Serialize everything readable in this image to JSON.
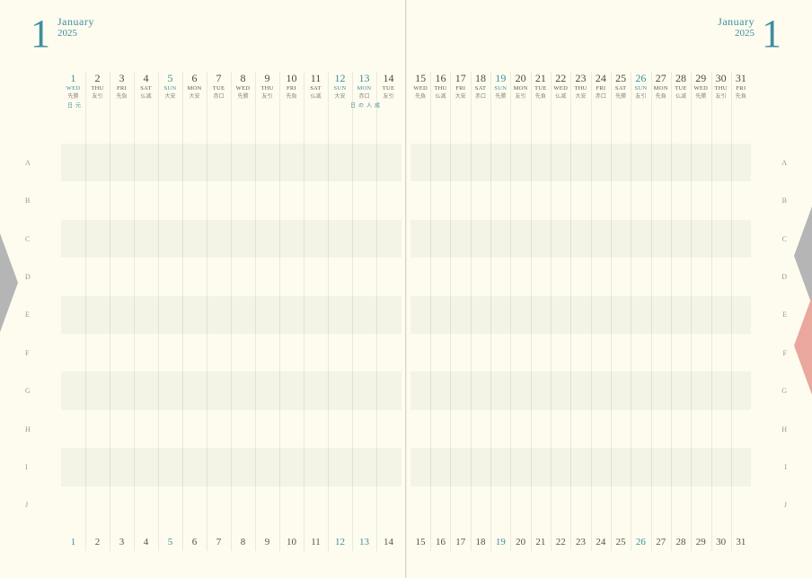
{
  "header": {
    "month_number": "1",
    "month_name": "January",
    "year": "2025"
  },
  "row_labels": [
    "A",
    "B",
    "C",
    "D",
    "E",
    "F",
    "G",
    "H",
    "I",
    "J"
  ],
  "days_left": [
    {
      "n": "1",
      "dow": "WED",
      "roku": "先勝",
      "hl": true,
      "note": "元日"
    },
    {
      "n": "2",
      "dow": "THU",
      "roku": "友引"
    },
    {
      "n": "3",
      "dow": "FRI",
      "roku": "先負"
    },
    {
      "n": "4",
      "dow": "SAT",
      "roku": "仏滅"
    },
    {
      "n": "5",
      "dow": "SUN",
      "roku": "大安",
      "hl": true
    },
    {
      "n": "6",
      "dow": "MON",
      "roku": "大安"
    },
    {
      "n": "7",
      "dow": "TUE",
      "roku": "赤口"
    },
    {
      "n": "8",
      "dow": "WED",
      "roku": "先勝"
    },
    {
      "n": "9",
      "dow": "THU",
      "roku": "友引"
    },
    {
      "n": "10",
      "dow": "FRI",
      "roku": "先負"
    },
    {
      "n": "11",
      "dow": "SAT",
      "roku": "仏滅"
    },
    {
      "n": "12",
      "dow": "SUN",
      "roku": "大安",
      "hl": true
    },
    {
      "n": "13",
      "dow": "MON",
      "roku": "赤口",
      "hl": true,
      "note": "成人の日"
    },
    {
      "n": "14",
      "dow": "TUE",
      "roku": "友引"
    }
  ],
  "days_right": [
    {
      "n": "15",
      "dow": "WED",
      "roku": "先負"
    },
    {
      "n": "16",
      "dow": "THU",
      "roku": "仏滅"
    },
    {
      "n": "17",
      "dow": "FRI",
      "roku": "大安"
    },
    {
      "n": "18",
      "dow": "SAT",
      "roku": "赤口"
    },
    {
      "n": "19",
      "dow": "SUN",
      "roku": "先勝",
      "hl": true
    },
    {
      "n": "20",
      "dow": "MON",
      "roku": "友引"
    },
    {
      "n": "21",
      "dow": "TUE",
      "roku": "先負"
    },
    {
      "n": "22",
      "dow": "WED",
      "roku": "仏滅"
    },
    {
      "n": "23",
      "dow": "THU",
      "roku": "大安"
    },
    {
      "n": "24",
      "dow": "FRI",
      "roku": "赤口"
    },
    {
      "n": "25",
      "dow": "SAT",
      "roku": "先勝"
    },
    {
      "n": "26",
      "dow": "SUN",
      "roku": "友引",
      "hl": true
    },
    {
      "n": "27",
      "dow": "MON",
      "roku": "先負"
    },
    {
      "n": "28",
      "dow": "TUE",
      "roku": "仏滅"
    },
    {
      "n": "29",
      "dow": "WED",
      "roku": "先勝"
    },
    {
      "n": "30",
      "dow": "THU",
      "roku": "友引"
    },
    {
      "n": "31",
      "dow": "FRI",
      "roku": "先負"
    }
  ]
}
